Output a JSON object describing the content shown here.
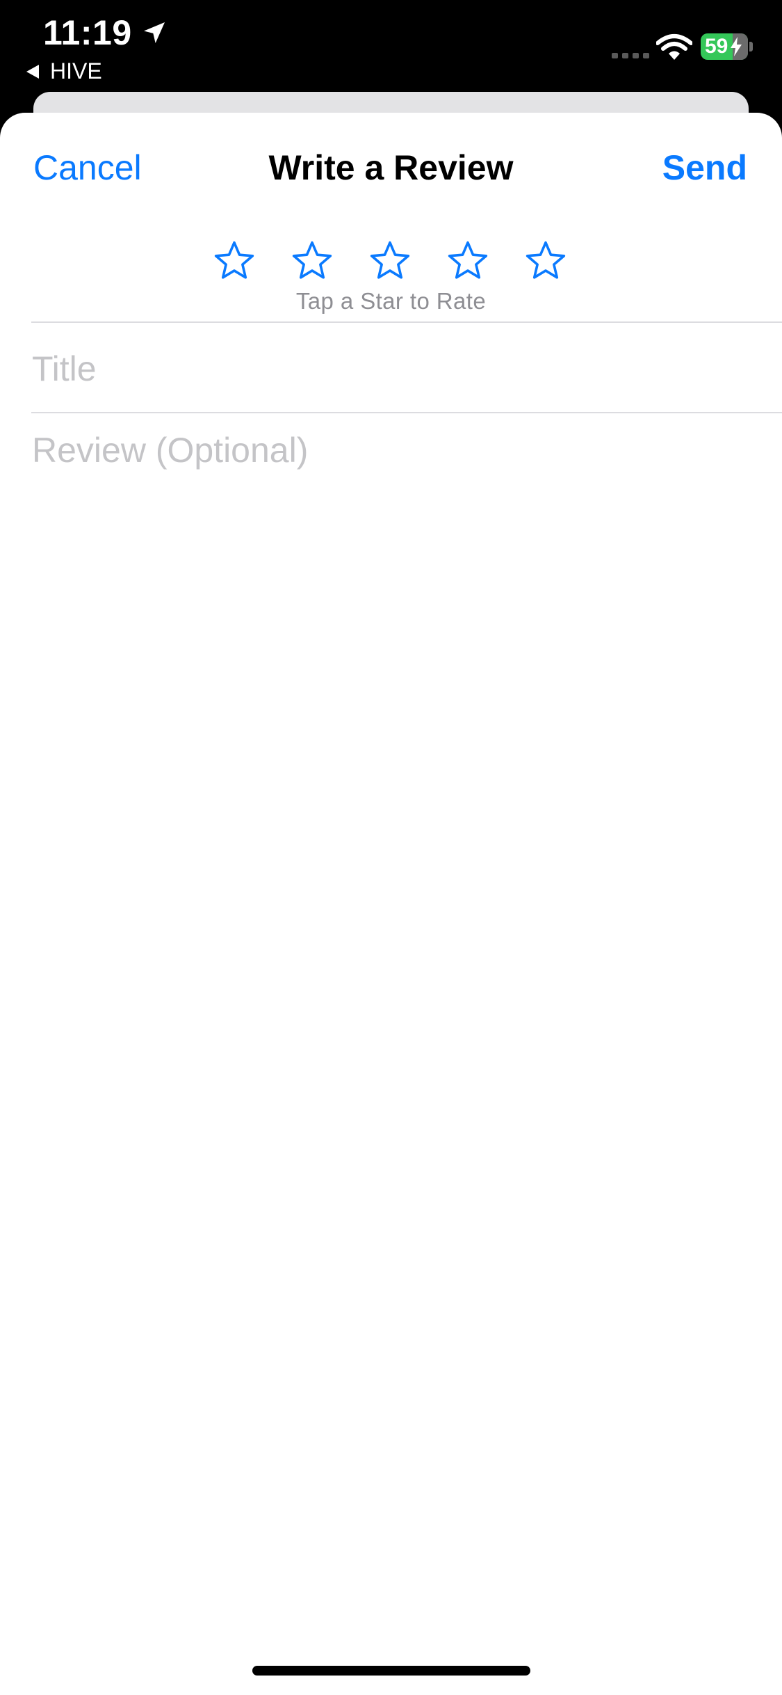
{
  "status_bar": {
    "time": "11:19",
    "back_app": "HIVE",
    "battery_level": "59",
    "battery_color": "#34c759",
    "icons": [
      "location-arrow-icon",
      "back-arrow-icon",
      "signal-icon",
      "wifi-icon",
      "battery-icon",
      "charging-bolt-icon"
    ]
  },
  "nav": {
    "cancel_label": "Cancel",
    "title": "Write a Review",
    "send_label": "Send"
  },
  "rating": {
    "star_count": 5,
    "selected": 0,
    "hint": "Tap a Star to Rate",
    "star_icon": "star-outline-icon",
    "accent_color": "#0a7aff"
  },
  "form": {
    "title_placeholder": "Title",
    "title_value": "",
    "review_placeholder": "Review (Optional)",
    "review_value": ""
  }
}
